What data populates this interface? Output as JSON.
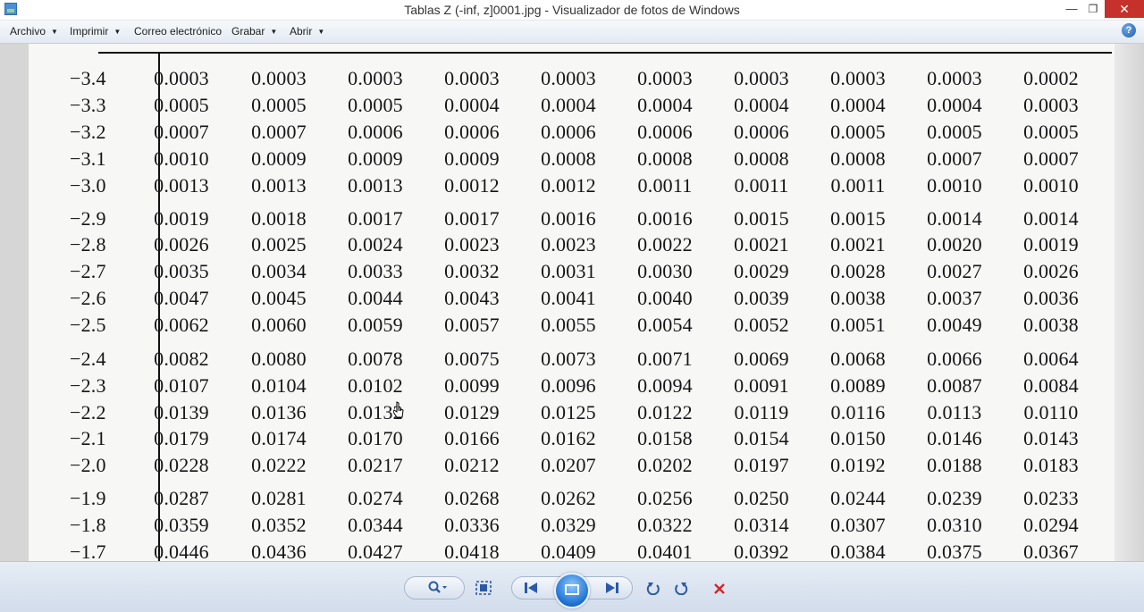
{
  "window": {
    "title": "Tablas Z (-inf, z]0001.jpg - Visualizador de fotos de Windows",
    "minimize": "—",
    "maximize": "❐",
    "close": "✕"
  },
  "menu": {
    "items": [
      {
        "label": "Archivo",
        "has_dropdown": true
      },
      {
        "label": "Imprimir",
        "has_dropdown": true
      },
      {
        "label": "Correo electrónico",
        "has_dropdown": false
      },
      {
        "label": "Grabar",
        "has_dropdown": true
      },
      {
        "label": "Abrir",
        "has_dropdown": true
      }
    ],
    "help": "?"
  },
  "table": {
    "rows": [
      {
        "z": "−3.4",
        "p": [
          "0.0003",
          "0.0003",
          "0.0003",
          "0.0003",
          "0.0003",
          "0.0003",
          "0.0003",
          "0.0003",
          "0.0003",
          "0.0002"
        ]
      },
      {
        "z": "−3.3",
        "p": [
          "0.0005",
          "0.0005",
          "0.0005",
          "0.0004",
          "0.0004",
          "0.0004",
          "0.0004",
          "0.0004",
          "0.0004",
          "0.0003"
        ]
      },
      {
        "z": "−3.2",
        "p": [
          "0.0007",
          "0.0007",
          "0.0006",
          "0.0006",
          "0.0006",
          "0.0006",
          "0.0006",
          "0.0005",
          "0.0005",
          "0.0005"
        ]
      },
      {
        "z": "−3.1",
        "p": [
          "0.0010",
          "0.0009",
          "0.0009",
          "0.0009",
          "0.0008",
          "0.0008",
          "0.0008",
          "0.0008",
          "0.0007",
          "0.0007"
        ]
      },
      {
        "z": "−3.0",
        "p": [
          "0.0013",
          "0.0013",
          "0.0013",
          "0.0012",
          "0.0012",
          "0.0011",
          "0.0011",
          "0.0011",
          "0.0010",
          "0.0010"
        ]
      },
      {
        "z": "−2.9",
        "p": [
          "0.0019",
          "0.0018",
          "0.0017",
          "0.0017",
          "0.0016",
          "0.0016",
          "0.0015",
          "0.0015",
          "0.0014",
          "0.0014"
        ]
      },
      {
        "z": "−2.8",
        "p": [
          "0.0026",
          "0.0025",
          "0.0024",
          "0.0023",
          "0.0023",
          "0.0022",
          "0.0021",
          "0.0021",
          "0.0020",
          "0.0019"
        ]
      },
      {
        "z": "−2.7",
        "p": [
          "0.0035",
          "0.0034",
          "0.0033",
          "0.0032",
          "0.0031",
          "0.0030",
          "0.0029",
          "0.0028",
          "0.0027",
          "0.0026"
        ]
      },
      {
        "z": "−2.6",
        "p": [
          "0.0047",
          "0.0045",
          "0.0044",
          "0.0043",
          "0.0041",
          "0.0040",
          "0.0039",
          "0.0038",
          "0.0037",
          "0.0036"
        ]
      },
      {
        "z": "−2.5",
        "p": [
          "0.0062",
          "0.0060",
          "0.0059",
          "0.0057",
          "0.0055",
          "0.0054",
          "0.0052",
          "0.0051",
          "0.0049",
          "0.0038"
        ]
      },
      {
        "z": "−2.4",
        "p": [
          "0.0082",
          "0.0080",
          "0.0078",
          "0.0075",
          "0.0073",
          "0.0071",
          "0.0069",
          "0.0068",
          "0.0066",
          "0.0064"
        ]
      },
      {
        "z": "−2.3",
        "p": [
          "0.0107",
          "0.0104",
          "0.0102",
          "0.0099",
          "0.0096",
          "0.0094",
          "0.0091",
          "0.0089",
          "0.0087",
          "0.0084"
        ]
      },
      {
        "z": "−2.2",
        "p": [
          "0.0139",
          "0.0136",
          "0.0132",
          "0.0129",
          "0.0125",
          "0.0122",
          "0.0119",
          "0.0116",
          "0.0113",
          "0.0110"
        ]
      },
      {
        "z": "−2.1",
        "p": [
          "0.0179",
          "0.0174",
          "0.0170",
          "0.0166",
          "0.0162",
          "0.0158",
          "0.0154",
          "0.0150",
          "0.0146",
          "0.0143"
        ]
      },
      {
        "z": "−2.0",
        "p": [
          "0.0228",
          "0.0222",
          "0.0217",
          "0.0212",
          "0.0207",
          "0.0202",
          "0.0197",
          "0.0192",
          "0.0188",
          "0.0183"
        ]
      },
      {
        "z": "−1.9",
        "p": [
          "0.0287",
          "0.0281",
          "0.0274",
          "0.0268",
          "0.0262",
          "0.0256",
          "0.0250",
          "0.0244",
          "0.0239",
          "0.0233"
        ]
      },
      {
        "z": "−1.8",
        "p": [
          "0.0359",
          "0.0352",
          "0.0344",
          "0.0336",
          "0.0329",
          "0.0322",
          "0.0314",
          "0.0307",
          "0.0310",
          "0.0294"
        ]
      },
      {
        "z": "−1.7",
        "p": [
          "0.0446",
          "0.0436",
          "0.0427",
          "0.0418",
          "0.0409",
          "0.0401",
          "0.0392",
          "0.0384",
          "0.0375",
          "0.0367"
        ]
      }
    ]
  },
  "toolbar": {
    "buttons": [
      {
        "name": "zoom",
        "icon": "magnifier-icon"
      },
      {
        "name": "actual-size",
        "icon": "fit-to-window-icon"
      },
      {
        "name": "previous",
        "icon": "previous-icon"
      },
      {
        "name": "slideshow",
        "icon": "slideshow-icon"
      },
      {
        "name": "next",
        "icon": "next-icon"
      },
      {
        "name": "rotate-left",
        "icon": "rotate-ccw-icon"
      },
      {
        "name": "rotate-right",
        "icon": "rotate-cw-icon"
      },
      {
        "name": "delete",
        "icon": "delete-icon"
      }
    ]
  },
  "colors": {
    "close_button": "#c7312b",
    "toolbar_icons": "#2a59a8",
    "delete_icon": "#d0262b"
  }
}
